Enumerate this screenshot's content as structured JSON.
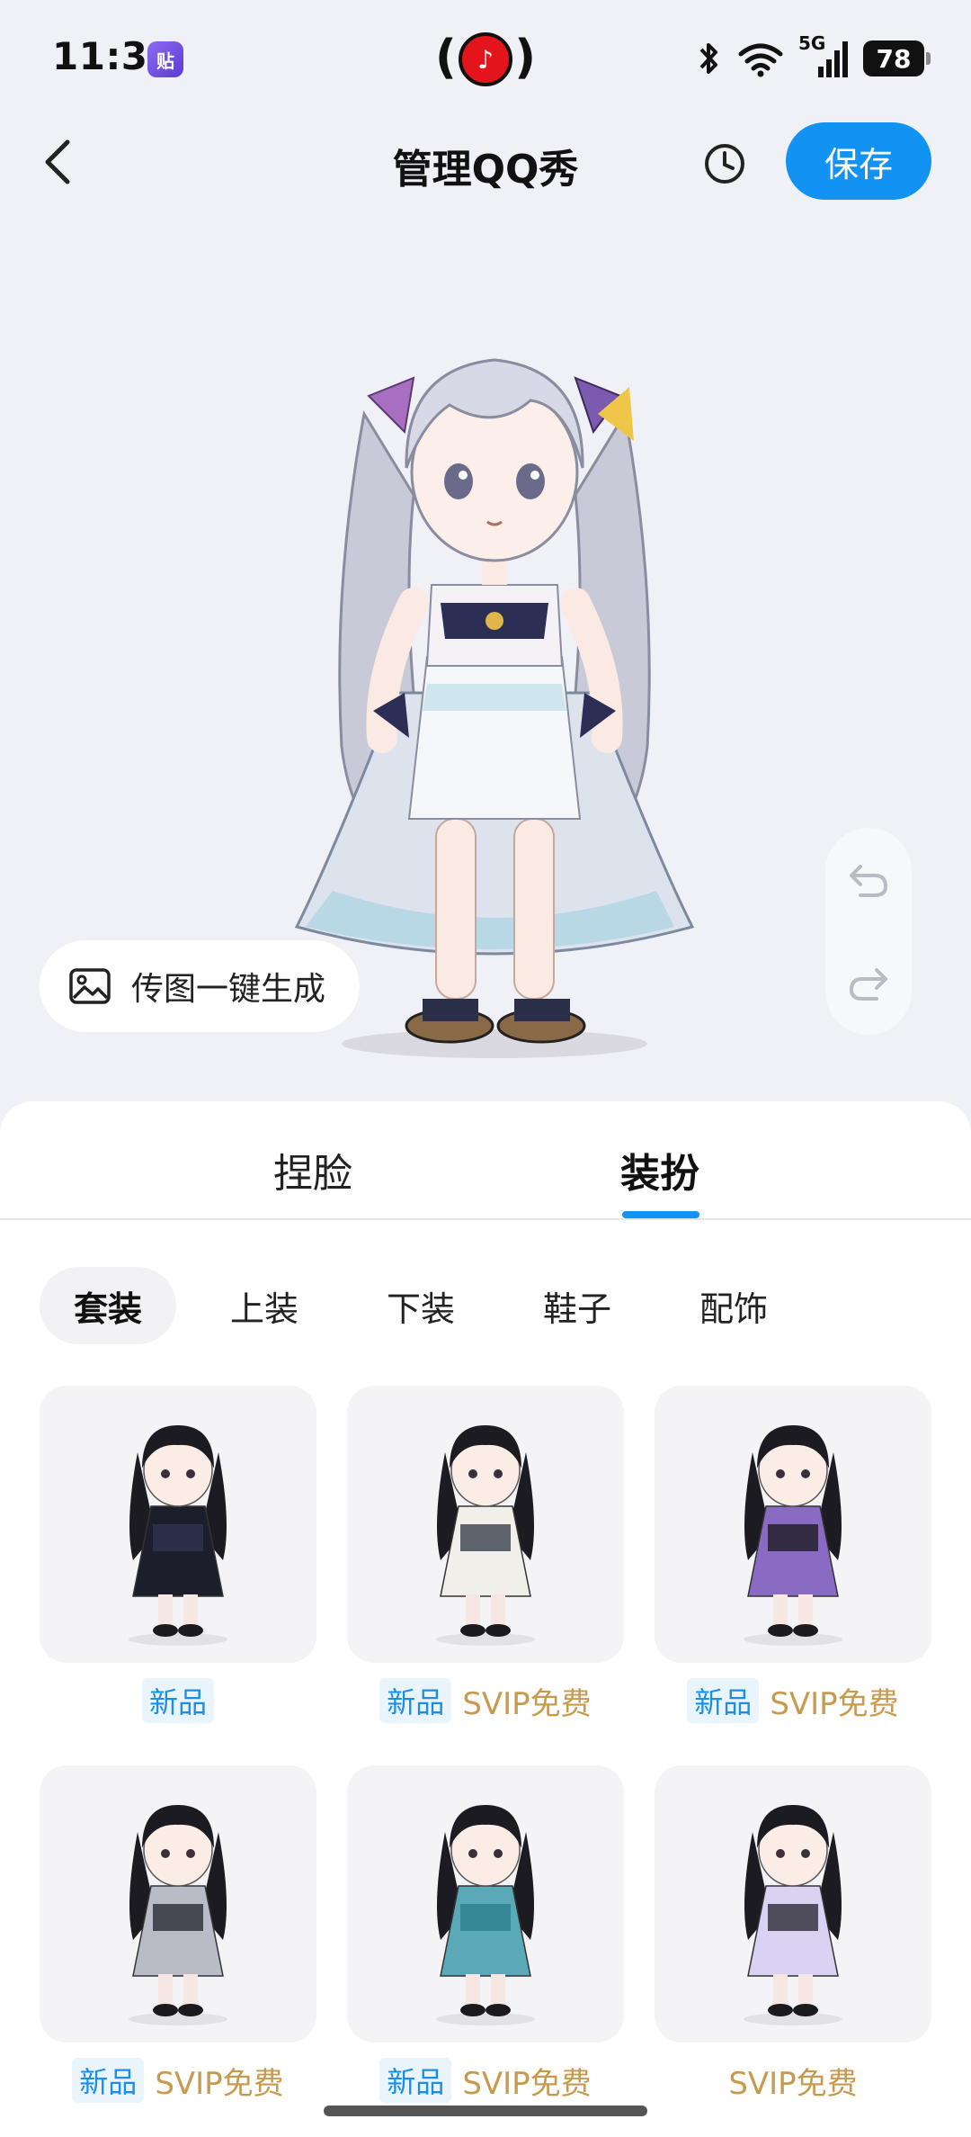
{
  "status_bar": {
    "time": "11:31",
    "app_icon_text": "贴",
    "battery": "78",
    "network": "5G"
  },
  "header": {
    "title": "管理QQ秀",
    "save_label": "保存"
  },
  "stage": {
    "upload_label": "传图一键生成"
  },
  "tabs": [
    {
      "label": "捏脸"
    },
    {
      "label": "装扮"
    }
  ],
  "categories": [
    {
      "label": "套装"
    },
    {
      "label": "上装"
    },
    {
      "label": "下装"
    },
    {
      "label": "鞋子"
    },
    {
      "label": "配饰"
    }
  ],
  "items": [
    {
      "tag_new": "新品",
      "tag_svip": "",
      "outfit": "graduation-gown",
      "colors": [
        "#1c1f2b",
        "#2f3550"
      ]
    },
    {
      "tag_new": "新品",
      "tag_svip": "SVIP免费",
      "outfit": "cat-ear-raccoon-tail",
      "colors": [
        "#f1efe9",
        "#3a3f4d"
      ]
    },
    {
      "tag_new": "新品",
      "tag_svip": "SVIP免费",
      "outfit": "purple-wings-punk",
      "colors": [
        "#8a6bc4",
        "#1b1b22"
      ]
    },
    {
      "tag_new": "新品",
      "tag_svip": "SVIP免费",
      "outfit": "silver-gothic-dress",
      "colors": [
        "#b9bcc6",
        "#2a2c34"
      ]
    },
    {
      "tag_new": "新品",
      "tag_svip": "SVIP免费",
      "outfit": "teal-ruffle-gown",
      "colors": [
        "#5aa9b8",
        "#2e7f8f"
      ]
    },
    {
      "tag_new": "",
      "tag_svip": "SVIP免费",
      "outfit": "lavender-cat-ear-jacket",
      "colors": [
        "#d9d2f3",
        "#2c2a36"
      ]
    }
  ]
}
